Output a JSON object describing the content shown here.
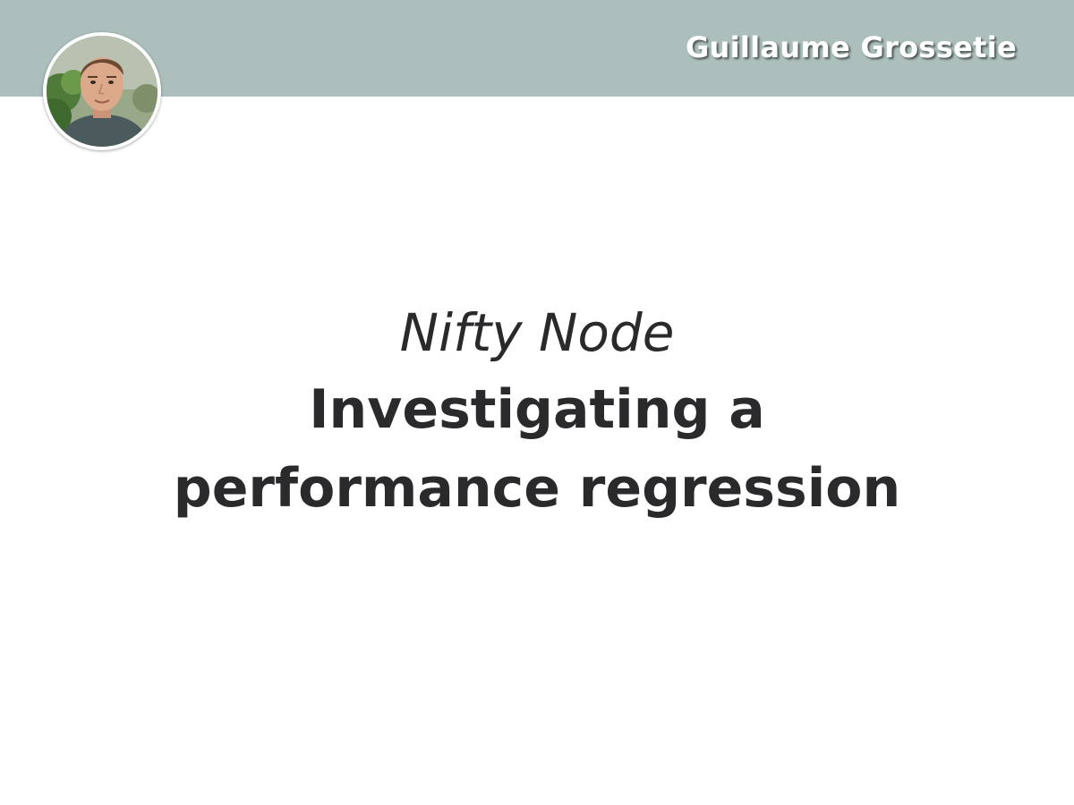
{
  "header": {
    "author_name": "Guillaume Grossetie",
    "background_color": "#acbfbc"
  },
  "avatar": {
    "icon": "person-photo"
  },
  "title": {
    "subtitle": "Nifty Node",
    "main_line1": "Investigating a",
    "main_line2": "performance regression",
    "text_color": "#2a2a2c"
  }
}
